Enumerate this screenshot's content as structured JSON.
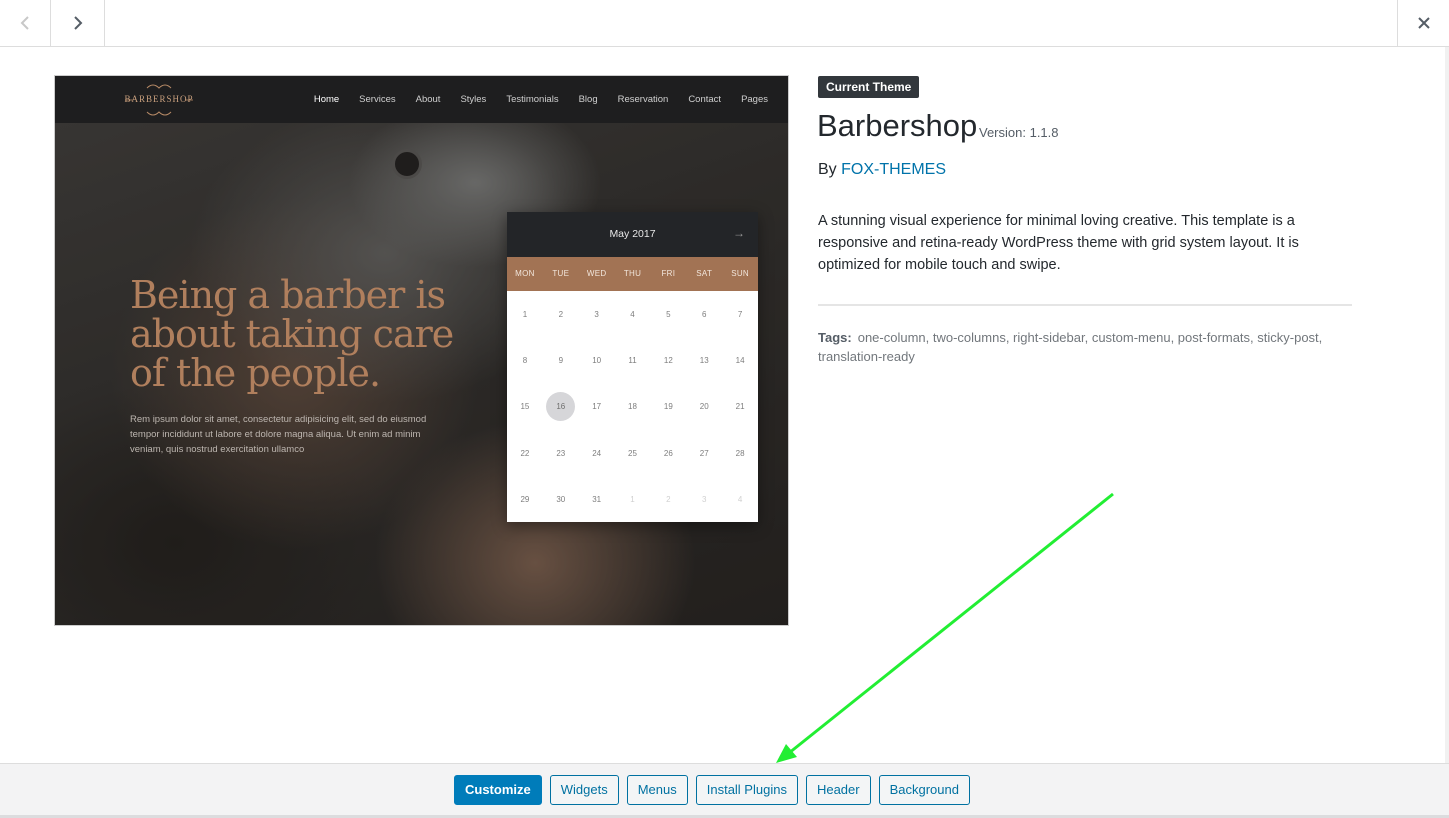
{
  "header": {
    "prev_icon": "chevron-left-icon",
    "next_icon": "chevron-right-icon",
    "close_icon": "close-icon"
  },
  "preview": {
    "logo_text": "BARBERSHOP",
    "menu": [
      "Home",
      "Services",
      "About",
      "Styles",
      "Testimonials",
      "Blog",
      "Reservation",
      "Contact",
      "Pages"
    ],
    "active_menu": "Home",
    "hero_title": "Being a barber is about taking care of the people.",
    "hero_text": "Rem ipsum dolor sit amet, consectetur adipisicing elit, sed do eiusmod tempor incididunt ut labore et dolore magna aliqua. Ut enim ad minim veniam, quis nostrud exercitation ullamco",
    "calendar": {
      "month": "May 2017",
      "next_arrow": "→",
      "weekdays": [
        "MON",
        "TUE",
        "WED",
        "THU",
        "FRI",
        "SAT",
        "SUN"
      ],
      "weeks": [
        [
          "1",
          "2",
          "3",
          "4",
          "5",
          "6",
          "7"
        ],
        [
          "8",
          "9",
          "10",
          "11",
          "12",
          "13",
          "14"
        ],
        [
          "15",
          "16",
          "17",
          "18",
          "19",
          "20",
          "21"
        ],
        [
          "22",
          "23",
          "24",
          "25",
          "26",
          "27",
          "28"
        ],
        [
          "29",
          "30",
          "31",
          "1",
          "2",
          "3",
          "4"
        ]
      ],
      "selected": "16"
    }
  },
  "theme": {
    "badge": "Current Theme",
    "name": "Barbershop",
    "version": "Version: 1.1.8",
    "author_prefix": "By",
    "author": "FOX-THEMES",
    "description": "A stunning visual experience for minimal loving creative. This template is a responsive and retina-ready WordPress theme with grid system layout. It is optimized for mobile touch and swipe.",
    "tags_label": "Tags:",
    "tags": "one-column, two-columns, right-sidebar, custom-menu, post-formats, sticky-post, translation-ready"
  },
  "actions": {
    "customize": "Customize",
    "widgets": "Widgets",
    "menus": "Menus",
    "install_plugins": "Install Plugins",
    "header": "Header",
    "background": "Background"
  },
  "colors": {
    "accent": "#0073aa",
    "primary_button": "#007cba",
    "annotation_arrow": "#22ee33"
  }
}
